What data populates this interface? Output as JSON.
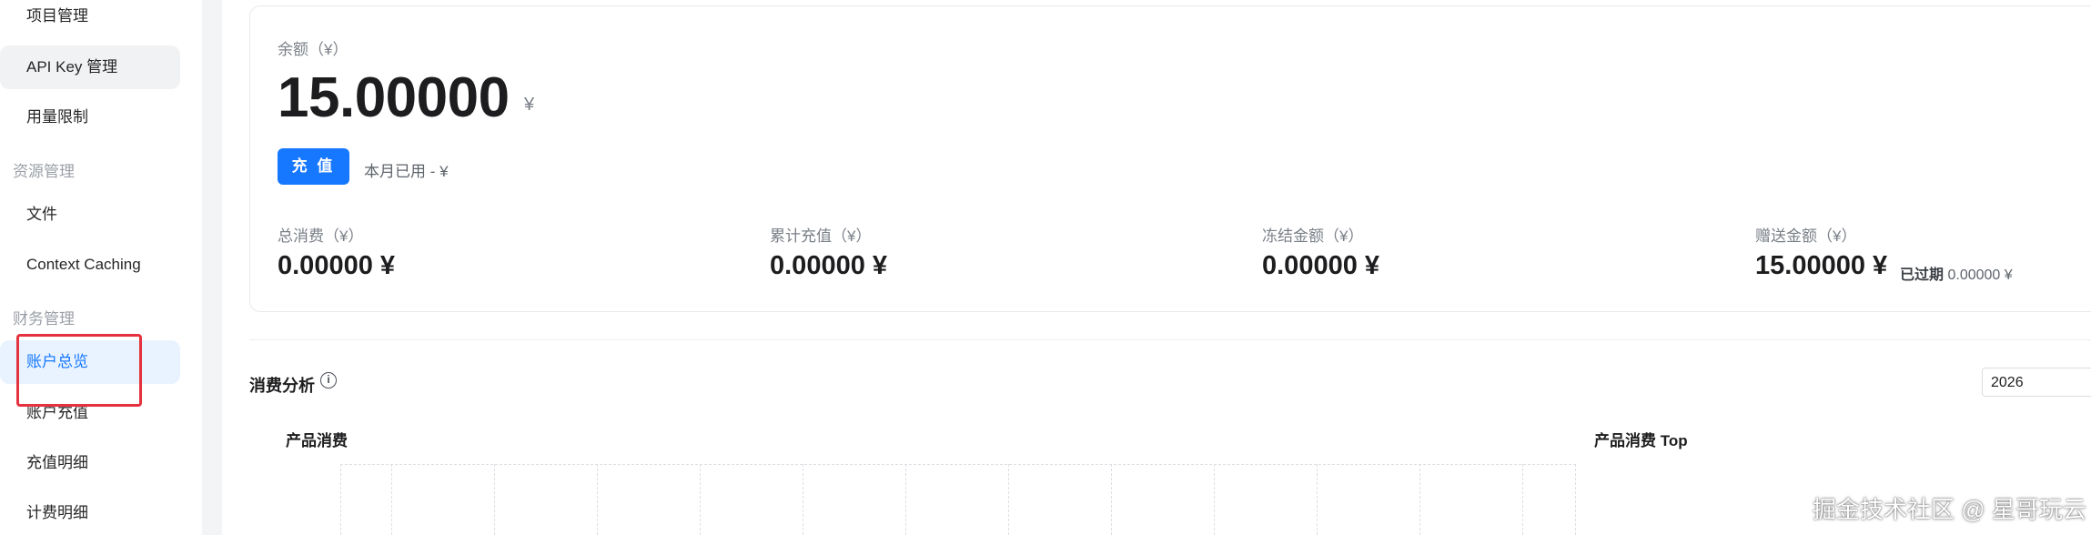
{
  "sidebar": {
    "items": [
      {
        "label": "项目管理"
      },
      {
        "label": "API Key 管理"
      },
      {
        "label": "用量限制"
      }
    ],
    "group_resources": "资源管理",
    "resources_items": [
      {
        "label": "文件"
      },
      {
        "label": "Context Caching"
      }
    ],
    "group_finance": "财务管理",
    "finance_items": [
      {
        "label": "账户总览"
      },
      {
        "label": "账户充值"
      },
      {
        "label": "充值明细"
      },
      {
        "label": "计费明细"
      }
    ]
  },
  "balance": {
    "label": "余额（¥）",
    "value": "15.00000",
    "unit": "¥",
    "recharge_button": "充 值",
    "month_used": "本月已用 - ¥"
  },
  "stats": [
    {
      "label": "总消费（¥）",
      "value": "0.00000 ¥"
    },
    {
      "label": "累计充值（¥）",
      "value": "0.00000 ¥"
    },
    {
      "label": "冻结金额（¥）",
      "value": "0.00000 ¥"
    },
    {
      "label": "赠送金额（¥）",
      "value": "15.00000 ¥"
    }
  ],
  "expired": {
    "label": "已过期",
    "value": "0.00000 ¥"
  },
  "analysis": {
    "title": "消费分析",
    "info_icon": "info-icon",
    "year": "2026"
  },
  "charts": {
    "product_consumption_title": "产品消费",
    "product_top_title": "产品消费 Top"
  },
  "watermark": "掘金技术社区 @ 星哥玩云",
  "colors": {
    "accent": "#1677ff",
    "active_bg": "#e8f3ff",
    "highlight_border": "#e5323f"
  }
}
